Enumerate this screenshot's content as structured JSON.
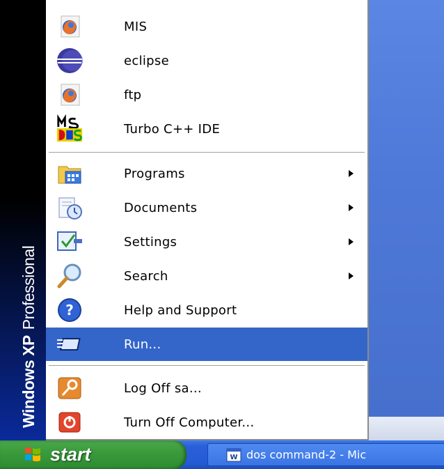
{
  "start_menu": {
    "banner": {
      "brand": "Windows XP",
      "edition": "Professional"
    },
    "pinned": [
      {
        "label": "MIS",
        "icon": "firefox-icon"
      },
      {
        "label": "eclipse",
        "icon": "eclipse-icon"
      },
      {
        "label": "ftp",
        "icon": "firefox-icon"
      },
      {
        "label": "Turbo C++ IDE",
        "icon": "ms-dos-icon"
      }
    ],
    "main": [
      {
        "label": "Programs",
        "icon": "programs-folder-icon",
        "submenu": true
      },
      {
        "label": "Documents",
        "icon": "documents-icon",
        "submenu": true
      },
      {
        "label": "Settings",
        "icon": "settings-icon",
        "submenu": true
      },
      {
        "label": "Search",
        "icon": "search-icon",
        "submenu": true
      },
      {
        "label": "Help and Support",
        "icon": "help-icon",
        "submenu": false
      },
      {
        "label": "Run...",
        "icon": "run-icon",
        "submenu": false,
        "selected": true
      }
    ],
    "footer": [
      {
        "label": "Log Off sa...",
        "icon": "key-icon"
      },
      {
        "label": "Turn Off Computer...",
        "icon": "power-icon"
      }
    ]
  },
  "taskbar": {
    "start_label": "start",
    "task_label": "dos command-2 - Mic",
    "task_icon": "word-document-icon"
  },
  "colors": {
    "selection": "#3465c9",
    "start_green": "#3a9b3d",
    "taskbar_blue": "#245bd4",
    "banner_blue": "#0a2a9a"
  }
}
